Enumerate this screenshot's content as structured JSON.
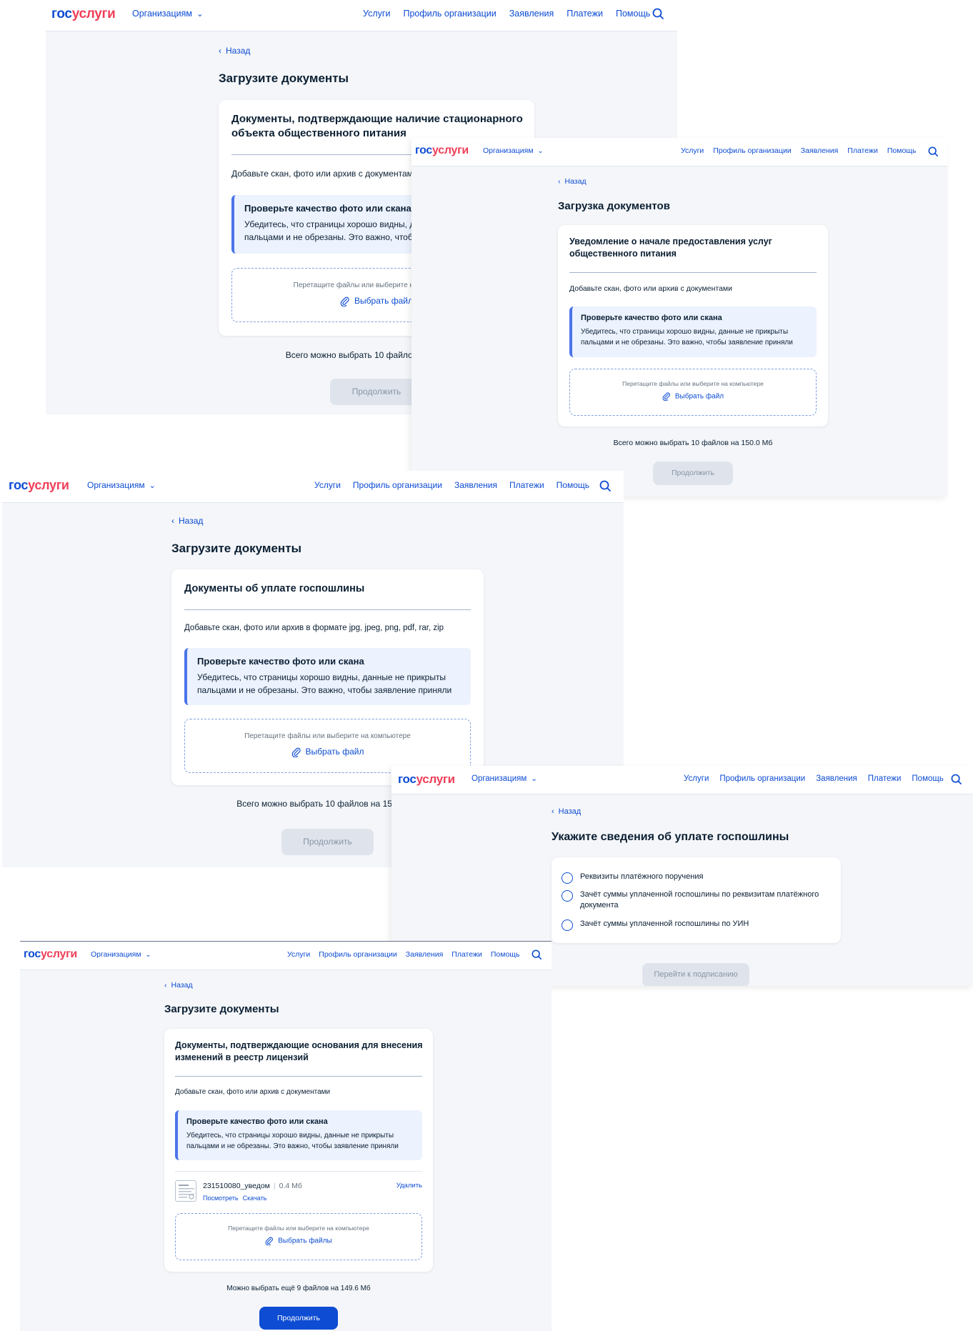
{
  "brand": {
    "part1": "гос",
    "part2": "услуги"
  },
  "nav": {
    "org": "Организациям",
    "services": "Услуги",
    "profile": "Профиль организации",
    "applications": "Заявления",
    "payments": "Платежи",
    "help": "Помощь"
  },
  "common": {
    "back": "Назад",
    "quality_title": "Проверьте качество фото или скана",
    "quality_text_1": "Убедитесь, что страницы хорошо видны, данные не прикрыты",
    "quality_text_2": "пальцами и не обрезаны. Это важно, чтобы заявление приняли",
    "drop_text": "Перетащите файлы или выберите на компьютере",
    "choose_file": "Выбрать файл",
    "choose_files": "Выбрать файлы",
    "continue": "Продолжить"
  },
  "screen1": {
    "page_title": "Загрузите документы",
    "card_title_1": "Документы, подтверждающие наличие стационарного",
    "card_title_2": "объекта общественного питания",
    "hint": "Добавьте скан, фото или архив с документами",
    "total": "Всего можно выбрать 10 файлов на 150.0 Мб"
  },
  "screen2": {
    "page_title": "Загрузка документов",
    "card_title_1": "Уведомление о начале предоставления услуг",
    "card_title_2": "общественного питания",
    "hint": "Добавьте скан, фото или архив с документами",
    "total": "Всего можно выбрать 10 файлов на 150.0 Мб"
  },
  "screen3": {
    "page_title": "Загрузите документы",
    "card_title": "Документы об уплате госпошлины",
    "hint": "Добавьте скан, фото или архив в формате jpg, jpeg, png, pdf, rar, zip",
    "total": "Всего можно выбрать 10 файлов на 150.0 Мб"
  },
  "screen4": {
    "page_title": "Укажите сведения об уплате госпошлины",
    "option_1": "Реквизиты платёжного поручения",
    "option_2a": "Зачёт суммы уплаченной госпошлины по реквизитам платёжного",
    "option_2b": "документа",
    "option_3": "Зачёт суммы уплаченной госпошлины по УИН",
    "submit": "Перейти к подписанию"
  },
  "screen5": {
    "page_title": "Загрузите документы",
    "card_title_1": "Документы, подтверждающие основания для внесения",
    "card_title_2": "изменений в реестр лицензий",
    "hint": "Добавьте скан, фото или архив с документами",
    "file_name": "231510080_уведом",
    "file_sep": "|",
    "file_size": "0.4 Мб",
    "view": "Посмотреть",
    "download": "Скачать",
    "delete": "Удалить",
    "total": "Можно выбрать ещё 9 файлов на 149.6 Мб"
  }
}
